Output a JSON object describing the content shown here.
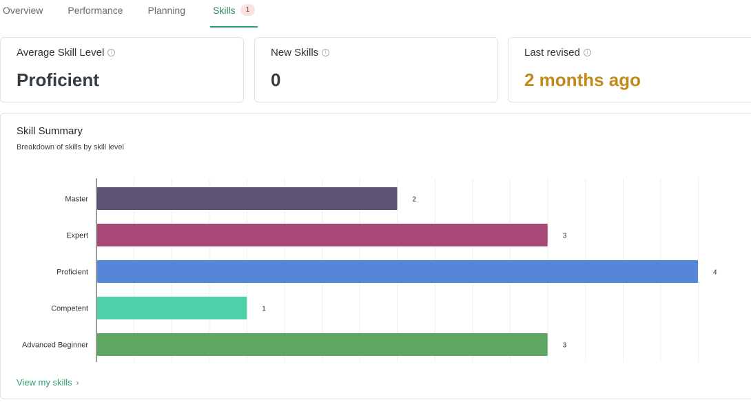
{
  "tabs": [
    {
      "label": "Overview",
      "active": false
    },
    {
      "label": "Performance",
      "active": false
    },
    {
      "label": "Planning",
      "active": false
    },
    {
      "label": "Skills",
      "active": true,
      "badge": "1"
    }
  ],
  "stats": [
    {
      "title": "Average Skill Level",
      "value": "Proficient"
    },
    {
      "title": "New Skills",
      "value": "0"
    },
    {
      "title": "Last revised",
      "value": "2 months ago",
      "value_color": "#c28a1a"
    }
  ],
  "summary": {
    "title": "Skill Summary",
    "subtitle": "Breakdown of skills by skill level",
    "link_label": "View my skills",
    "link_icon": "chevron-right-icon"
  },
  "chart_data": {
    "type": "bar",
    "orientation": "horizontal",
    "categories": [
      "Master",
      "Expert",
      "Proficient",
      "Competent",
      "Advanced Beginner"
    ],
    "values": [
      2,
      3,
      4,
      1,
      3
    ],
    "colors": [
      "#5c5275",
      "#a84876",
      "#5686d8",
      "#4ed1a8",
      "#5ea762"
    ],
    "xlim": [
      0,
      4
    ],
    "grid": true,
    "legend": "none",
    "data_labels": true
  }
}
